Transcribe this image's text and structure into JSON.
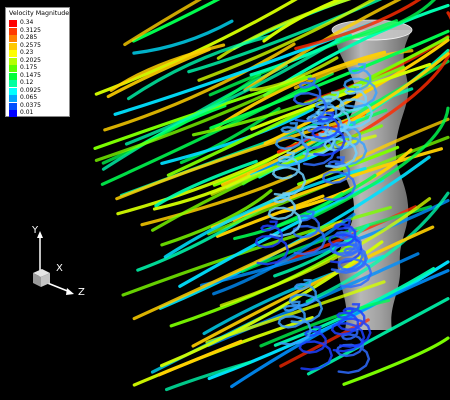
{
  "legend": {
    "title": "Velocity Magnitude",
    "items": [
      {
        "value": "0.34",
        "color": "#ff0000"
      },
      {
        "value": "0.3125",
        "color": "#ff3a00"
      },
      {
        "value": "0.285",
        "color": "#ff8000"
      },
      {
        "value": "0.2575",
        "color": "#ffc800"
      },
      {
        "value": "0.23",
        "color": "#ffff00"
      },
      {
        "value": "0.2025",
        "color": "#b4ff00"
      },
      {
        "value": "0.175",
        "color": "#5cff00"
      },
      {
        "value": "0.1475",
        "color": "#00ff3c"
      },
      {
        "value": "0.12",
        "color": "#00ffa0"
      },
      {
        "value": "0.0925",
        "color": "#00ffff"
      },
      {
        "value": "0.065",
        "color": "#00a6ff"
      },
      {
        "value": "0.0375",
        "color": "#0050ff"
      },
      {
        "value": "0.01",
        "color": "#0000ff"
      }
    ]
  },
  "axes": {
    "y": "Y",
    "x": "X",
    "z": "Z"
  },
  "colors": {
    "background": "#000000",
    "cylinder": "#b8b8b8"
  }
}
